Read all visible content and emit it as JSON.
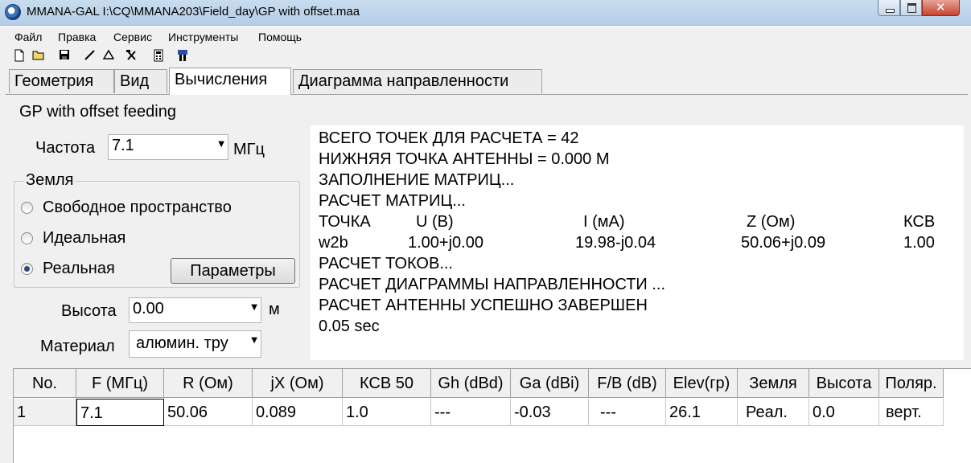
{
  "window": {
    "title": "MMANA-GAL I:\\CQ\\MMANA203\\Field_day\\GP with offset.maa"
  },
  "menu": [
    "Файл",
    "Правка",
    "Сервис",
    "Инструменты",
    "Помощь"
  ],
  "toolbar": {
    "icons": [
      "new-file-icon",
      "open-folder-icon",
      "save-icon",
      "wire-icon",
      "triangle-icon",
      "tools-icon",
      "calculator-icon",
      "optimize-icon"
    ]
  },
  "tabs": [
    "Геометрия",
    "Вид",
    "Вычисления",
    "Диаграмма направленности"
  ],
  "active_tab": "Вычисления",
  "antenna_name": "GP  with offset feeding",
  "frequency": {
    "label": "Частота",
    "value": "7.1",
    "unit": "МГц"
  },
  "ground": {
    "legend": "Земля",
    "options": [
      "Свободное пространство",
      "Идеальная",
      "Реальная"
    ],
    "selected": "Реальная",
    "params_button": "Параметры"
  },
  "height": {
    "label": "Высота",
    "value": "0.00",
    "unit": "м"
  },
  "material": {
    "label": "Материал",
    "value": "алюмин. тру"
  },
  "output": {
    "lines": [
      "ВСЕГО ТОЧЕК ДЛЯ РАСЧЕТА = 42",
      "НИЖНЯЯ ТОЧКА АНТЕННЫ = 0.000 М",
      "ЗАПОЛНЕНИЕ МАТРИЦ...",
      "РАСЧЕТ МАТРИЦ..."
    ],
    "source_table": {
      "headers": [
        "ТОЧКА",
        "U (В)",
        "I (мА)",
        "Z (Ом)",
        "КСВ"
      ],
      "row": [
        "w2b",
        "1.00+j0.00",
        "19.98-j0.04",
        "50.06+j0.09",
        "1.00"
      ]
    },
    "lines_after": [
      "РАСЧЕТ ТОКОВ...",
      "РАСЧЕТ ДИАГРАММЫ НАПРАВЛЕННОСТИ ...",
      "РАСЧЕТ АНТЕННЫ УСПЕШНО ЗАВЕРШЕН",
      "0.05 sec"
    ]
  },
  "results_table": {
    "headers": [
      "No.",
      "F (МГц)",
      "R (Ом)",
      "jX (Ом)",
      "КСВ 50",
      "Gh (dBd)",
      "Ga (dBi)",
      "F/B (dB)",
      "Elev(гр)",
      "Земля",
      "Высота",
      "Поляр."
    ],
    "rows": [
      [
        "1",
        "7.1",
        "50.06",
        "0.089",
        "1.0",
        "---",
        "-0.03",
        "---",
        "26.1",
        "Реал.",
        "0.0",
        "верт."
      ]
    ]
  }
}
